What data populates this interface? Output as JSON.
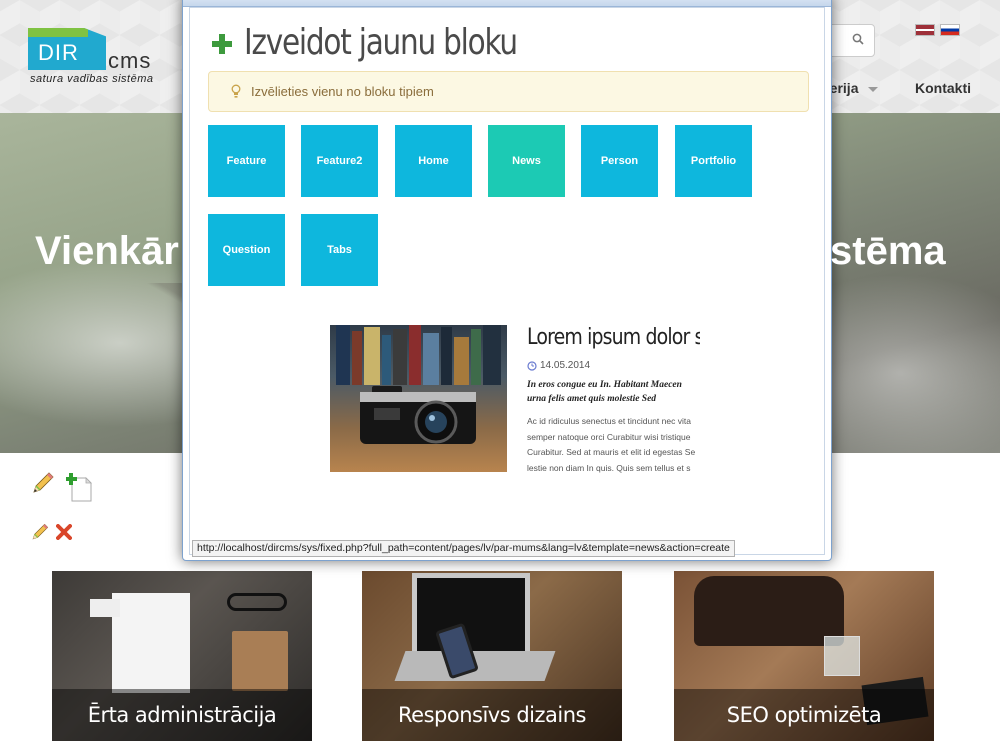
{
  "site": {
    "logo": {
      "dir": "DIR",
      "cms": "cms",
      "tagline": "satura vadības sistēma"
    },
    "languages": [
      {
        "code": "lv",
        "icon": "flag-latvia-icon"
      },
      {
        "code": "ru",
        "icon": "flag-russia-icon"
      }
    ],
    "search": {
      "icon": "search-icon"
    },
    "nav": {
      "galerija": "alerija",
      "kontakti": "Kontakti"
    },
    "hero": {
      "left_text": "Vienkār",
      "right_text": "stēma"
    },
    "edit_tools": [
      {
        "icon": "pencil-icon"
      },
      {
        "icon": "add-page-icon"
      },
      {
        "icon": "pencil-icon"
      },
      {
        "icon": "delete-icon"
      }
    ],
    "feature_cards": [
      {
        "caption": "Ērta administrācija"
      },
      {
        "caption": "Responsīvs dizains"
      },
      {
        "caption": "SEO optimizēta"
      }
    ]
  },
  "modal": {
    "title": "Izveidot jaunu bloku",
    "title_icon": "plus-icon",
    "alert": {
      "icon": "lightbulb-icon",
      "text": "Izvēlieties vienu no bloku tipiem"
    },
    "block_types": [
      {
        "label": "Feature",
        "active": false
      },
      {
        "label": "Feature2",
        "active": false
      },
      {
        "label": "Home",
        "active": false
      },
      {
        "label": "News",
        "active": true
      },
      {
        "label": "Person",
        "active": false
      },
      {
        "label": "Portfolio",
        "active": false
      },
      {
        "label": "Question",
        "active": false
      },
      {
        "label": "Tabs",
        "active": false
      }
    ],
    "preview": {
      "title": "Lorem ipsum dolor si",
      "date": "14.05.2014",
      "lead_lines": [
        "In eros congue eu In. Habitant Maecen",
        "urna felis amet quis molestie Sed"
      ],
      "body_lines": [
        "Ac id ridiculus senectus et tincidunt nec vita",
        "semper natoque orci Curabitur wisi tristique",
        "Curabitur. Sed at mauris et elit id egestas Se",
        "lestie non diam In quis. Quis sem tellus et s"
      ]
    },
    "status_url": "http://localhost/dircms/sys/fixed.php?full_path=content/pages/lv/par-mums&lang=lv&template=news&action=create"
  },
  "colors": {
    "tile": "#0eb7dd",
    "tile_active": "#1ccab4",
    "alert_bg": "#fcf8e3",
    "alert_text": "#8a6d3b",
    "logo_blue": "#21a9cf",
    "logo_green": "#7fc242"
  }
}
